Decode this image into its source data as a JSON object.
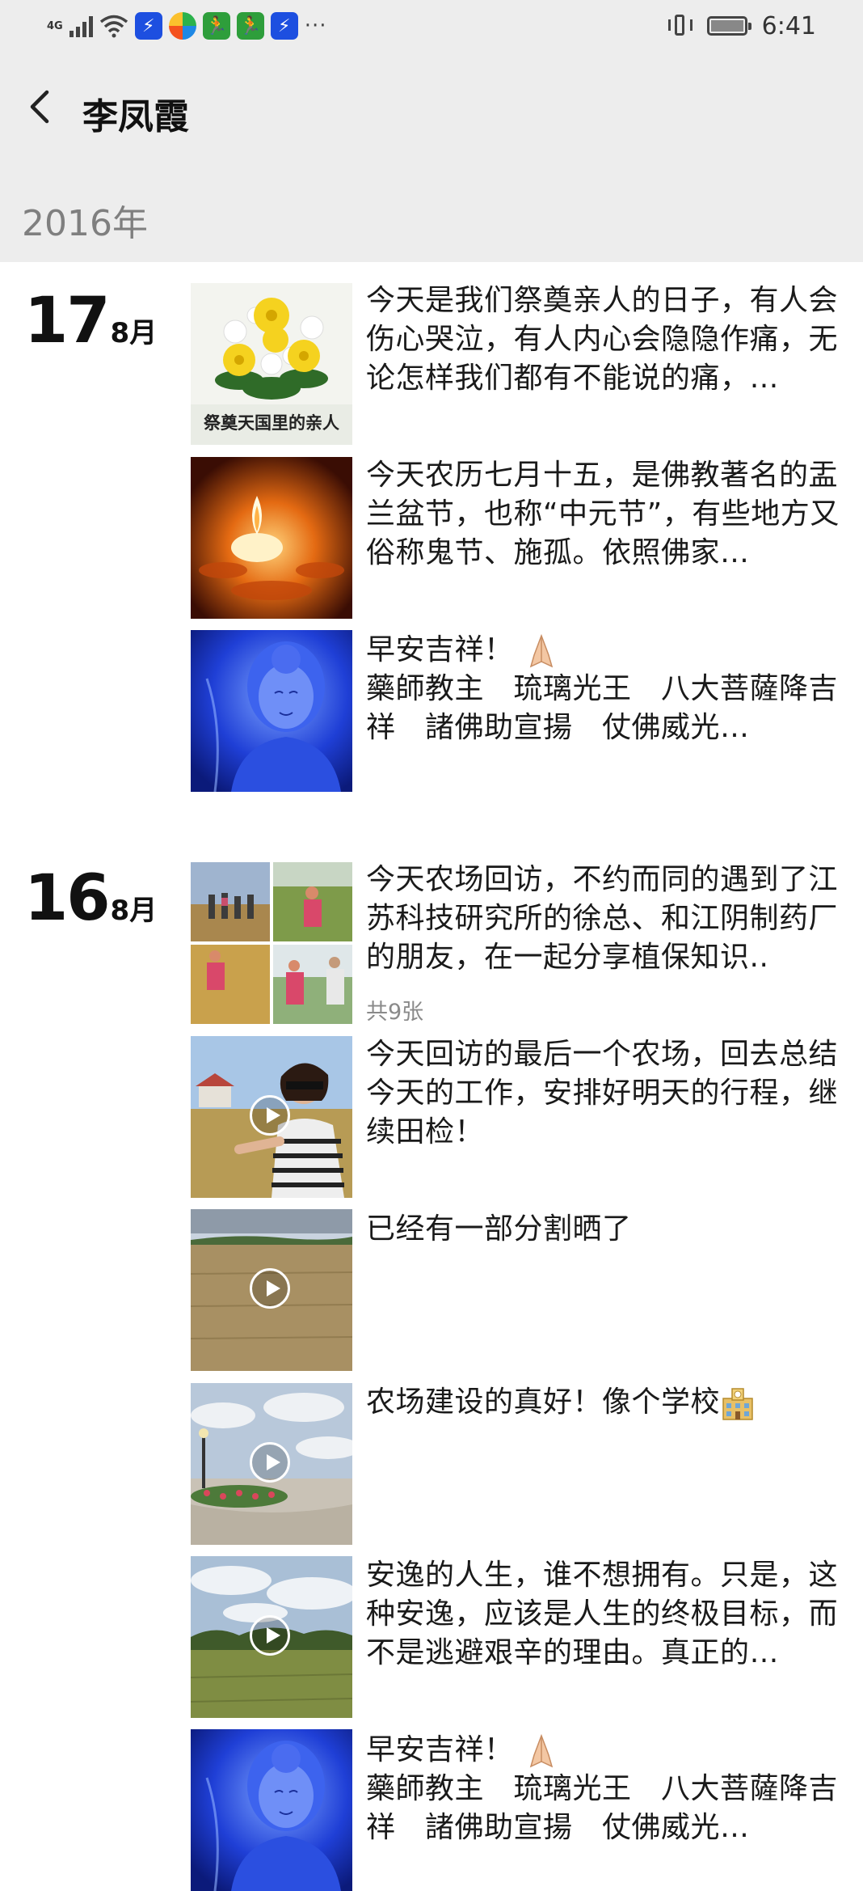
{
  "status_bar": {
    "network": "4G",
    "time": "6:41",
    "more": "···"
  },
  "header": {
    "title": "李凤霞"
  },
  "year_label": "2016年",
  "groups": [
    {
      "day": "17",
      "month": "8月",
      "posts": [
        {
          "text": "今天是我们祭奠亲人的日子，有人会伤心哭泣，有人内心会隐隐作痛，无论怎样我们都有不能说的痛，…",
          "thumb_caption": "祭奠天国里的亲人",
          "thumb": "flowers"
        },
        {
          "text": "今天农历七月十五，是佛教著名的盂兰盆节，也称“中元节”，有些地方又俗称鬼节、施孤。依照佛家…",
          "thumb": "candle"
        },
        {
          "text_line1": "早安吉祥！",
          "text_line2": "藥師教主　琉璃光王　八大菩薩降吉祥　諸佛助宣揚　仗佛威光…",
          "emoji": "folded-hands-icon",
          "thumb": "buddha"
        }
      ]
    },
    {
      "day": "16",
      "month": "8月",
      "posts": [
        {
          "text": "今天农场回访，不约而同的遇到了江苏科技研究所的徐总、和江阴制药厂的朋友，在一起分享植保知识..",
          "photo_count": "共9张",
          "thumb": "grid"
        },
        {
          "text": "今天回访的最后一个农场，回去总结今天的工作，安排好明天的行程，继续田检！",
          "thumb": "woman-field",
          "video": true
        },
        {
          "text": "已经有一部分割晒了",
          "thumb": "wheat",
          "video": true
        },
        {
          "text": "农场建设的真好！像个学校",
          "emoji": "school-icon",
          "thumb": "park",
          "video": true
        },
        {
          "text": "安逸的人生，谁不想拥有。只是，这种安逸，应该是人生的终极目标，而不是逃避艰辛的理由。真正的…",
          "thumb": "sky-trees",
          "video": true
        },
        {
          "text_line1": "早安吉祥！",
          "text_line2": "藥師教主　琉璃光王　八大菩薩降吉祥　諸佛助宣揚　仗佛威光…",
          "emoji": "folded-hands-icon",
          "thumb": "buddha"
        }
      ]
    }
  ]
}
